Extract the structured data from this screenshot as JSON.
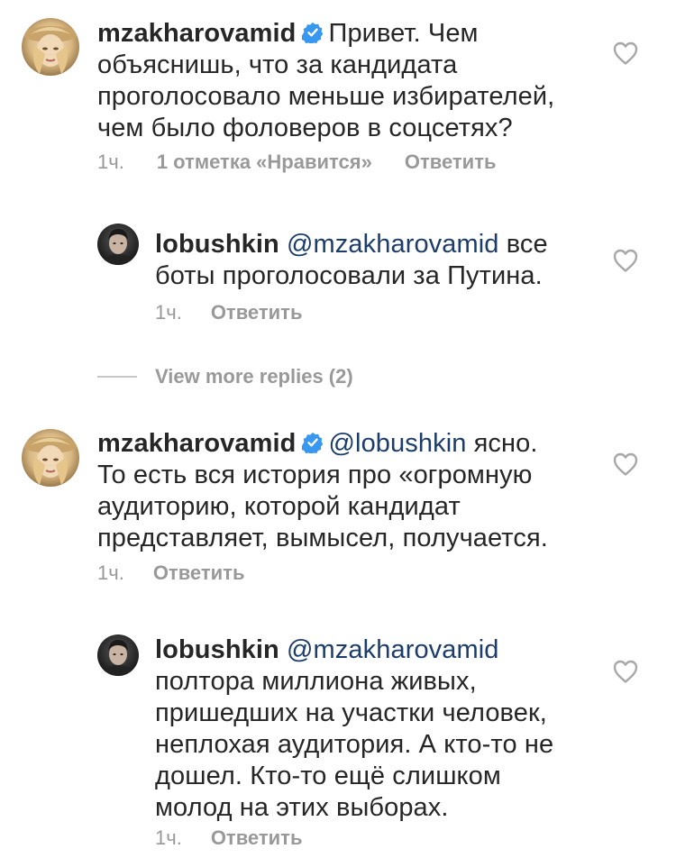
{
  "comments": [
    {
      "username": "mzakharovamid",
      "verified": true,
      "text": "Привет. Чем объяснишь, что за кандидата проголосовало меньше избирателей, чем было фоловеров в соцсетях?",
      "time": "1ч.",
      "likes": "1 отметка «Нравится»",
      "reply": "Ответить",
      "avatar": "blonde-woman-avatar"
    },
    {
      "username": "lobushkin",
      "mention": "@mzakharovamid",
      "text": " все боты проголосовали за Путина.",
      "time": "1ч.",
      "reply": "Ответить",
      "avatar": "dark-haired-man-avatar"
    },
    {
      "username": "mzakharovamid",
      "verified": true,
      "mention": "@lobushkin",
      "text": " ясно. То есть вся история про «огромную аудиторию, которой кандидат представляет, вымысел, получается.",
      "time": "1ч.",
      "reply": "Ответить",
      "avatar": "blonde-woman-avatar"
    },
    {
      "username": "lobushkin",
      "mention": "@mzakharovamid",
      "text": " полтора миллиона живых, пришедших на участки человек, неплохая аудитория. А кто-то не дошел. Кто-то ещё слишком молод на этих выборах.",
      "time": "1ч.",
      "reply": "Ответить",
      "avatar": "dark-haired-man-avatar"
    }
  ],
  "view_more": "View more replies (2)",
  "colors": {
    "text": "#262626",
    "mention": "#1c3d6b",
    "meta": "#999999",
    "verified": "#3897f0",
    "heart": "#a8a8a8"
  },
  "icons": [
    "verified-badge-icon",
    "heart-icon"
  ]
}
